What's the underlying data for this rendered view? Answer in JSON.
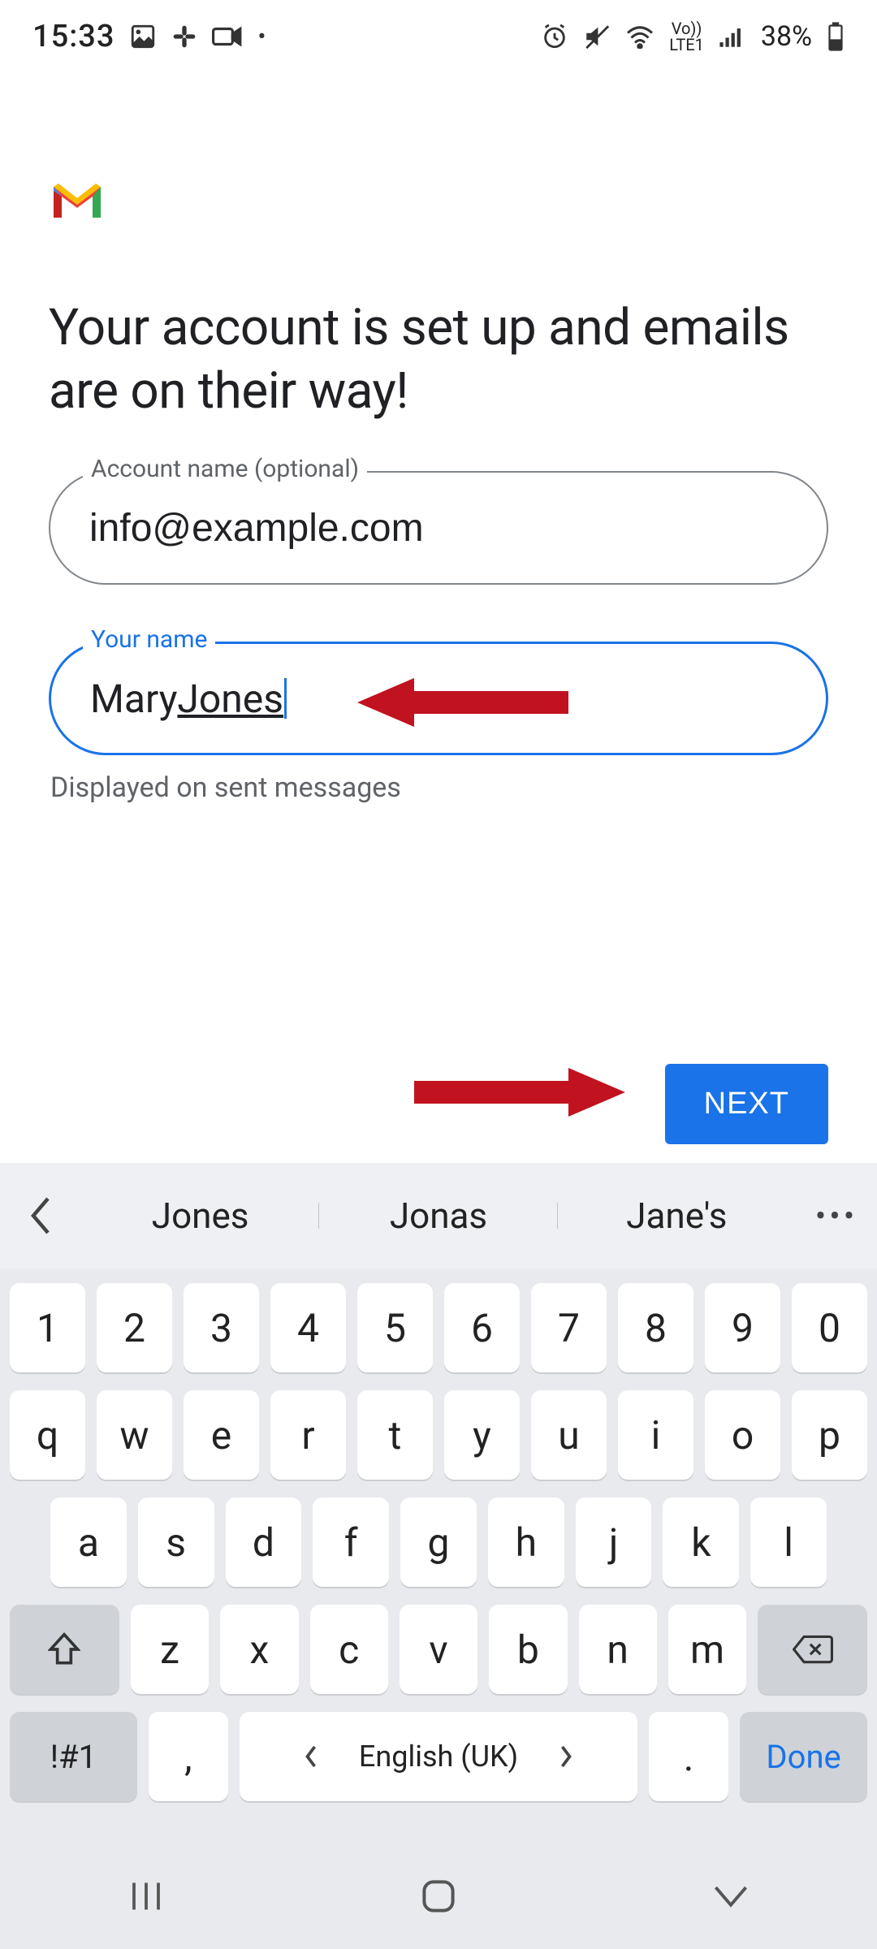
{
  "statusbar": {
    "time": "15:33",
    "battery": "38%",
    "lte": "LTE1",
    "vo": "Vo))"
  },
  "content": {
    "heading": "Your account is set up and emails are on their way!",
    "account_label": "Account name (optional)",
    "account_value": "info@example.com",
    "name_label": "Your name",
    "name_value_first": "Mary ",
    "name_value_last": "Jones",
    "helper": "Displayed on sent messages",
    "next_button": "NEXT"
  },
  "keyboard": {
    "suggestions": [
      "Jones",
      "Jonas",
      "Jane's"
    ],
    "row1": [
      "1",
      "2",
      "3",
      "4",
      "5",
      "6",
      "7",
      "8",
      "9",
      "0"
    ],
    "row2": [
      "q",
      "w",
      "e",
      "r",
      "t",
      "y",
      "u",
      "i",
      "o",
      "p"
    ],
    "row3": [
      "a",
      "s",
      "d",
      "f",
      "g",
      "h",
      "j",
      "k",
      "l"
    ],
    "row4": [
      "z",
      "x",
      "c",
      "v",
      "b",
      "n",
      "m"
    ],
    "sym": "!#1",
    "comma": ",",
    "space_label": "English (UK)",
    "period": ".",
    "done": "Done"
  }
}
